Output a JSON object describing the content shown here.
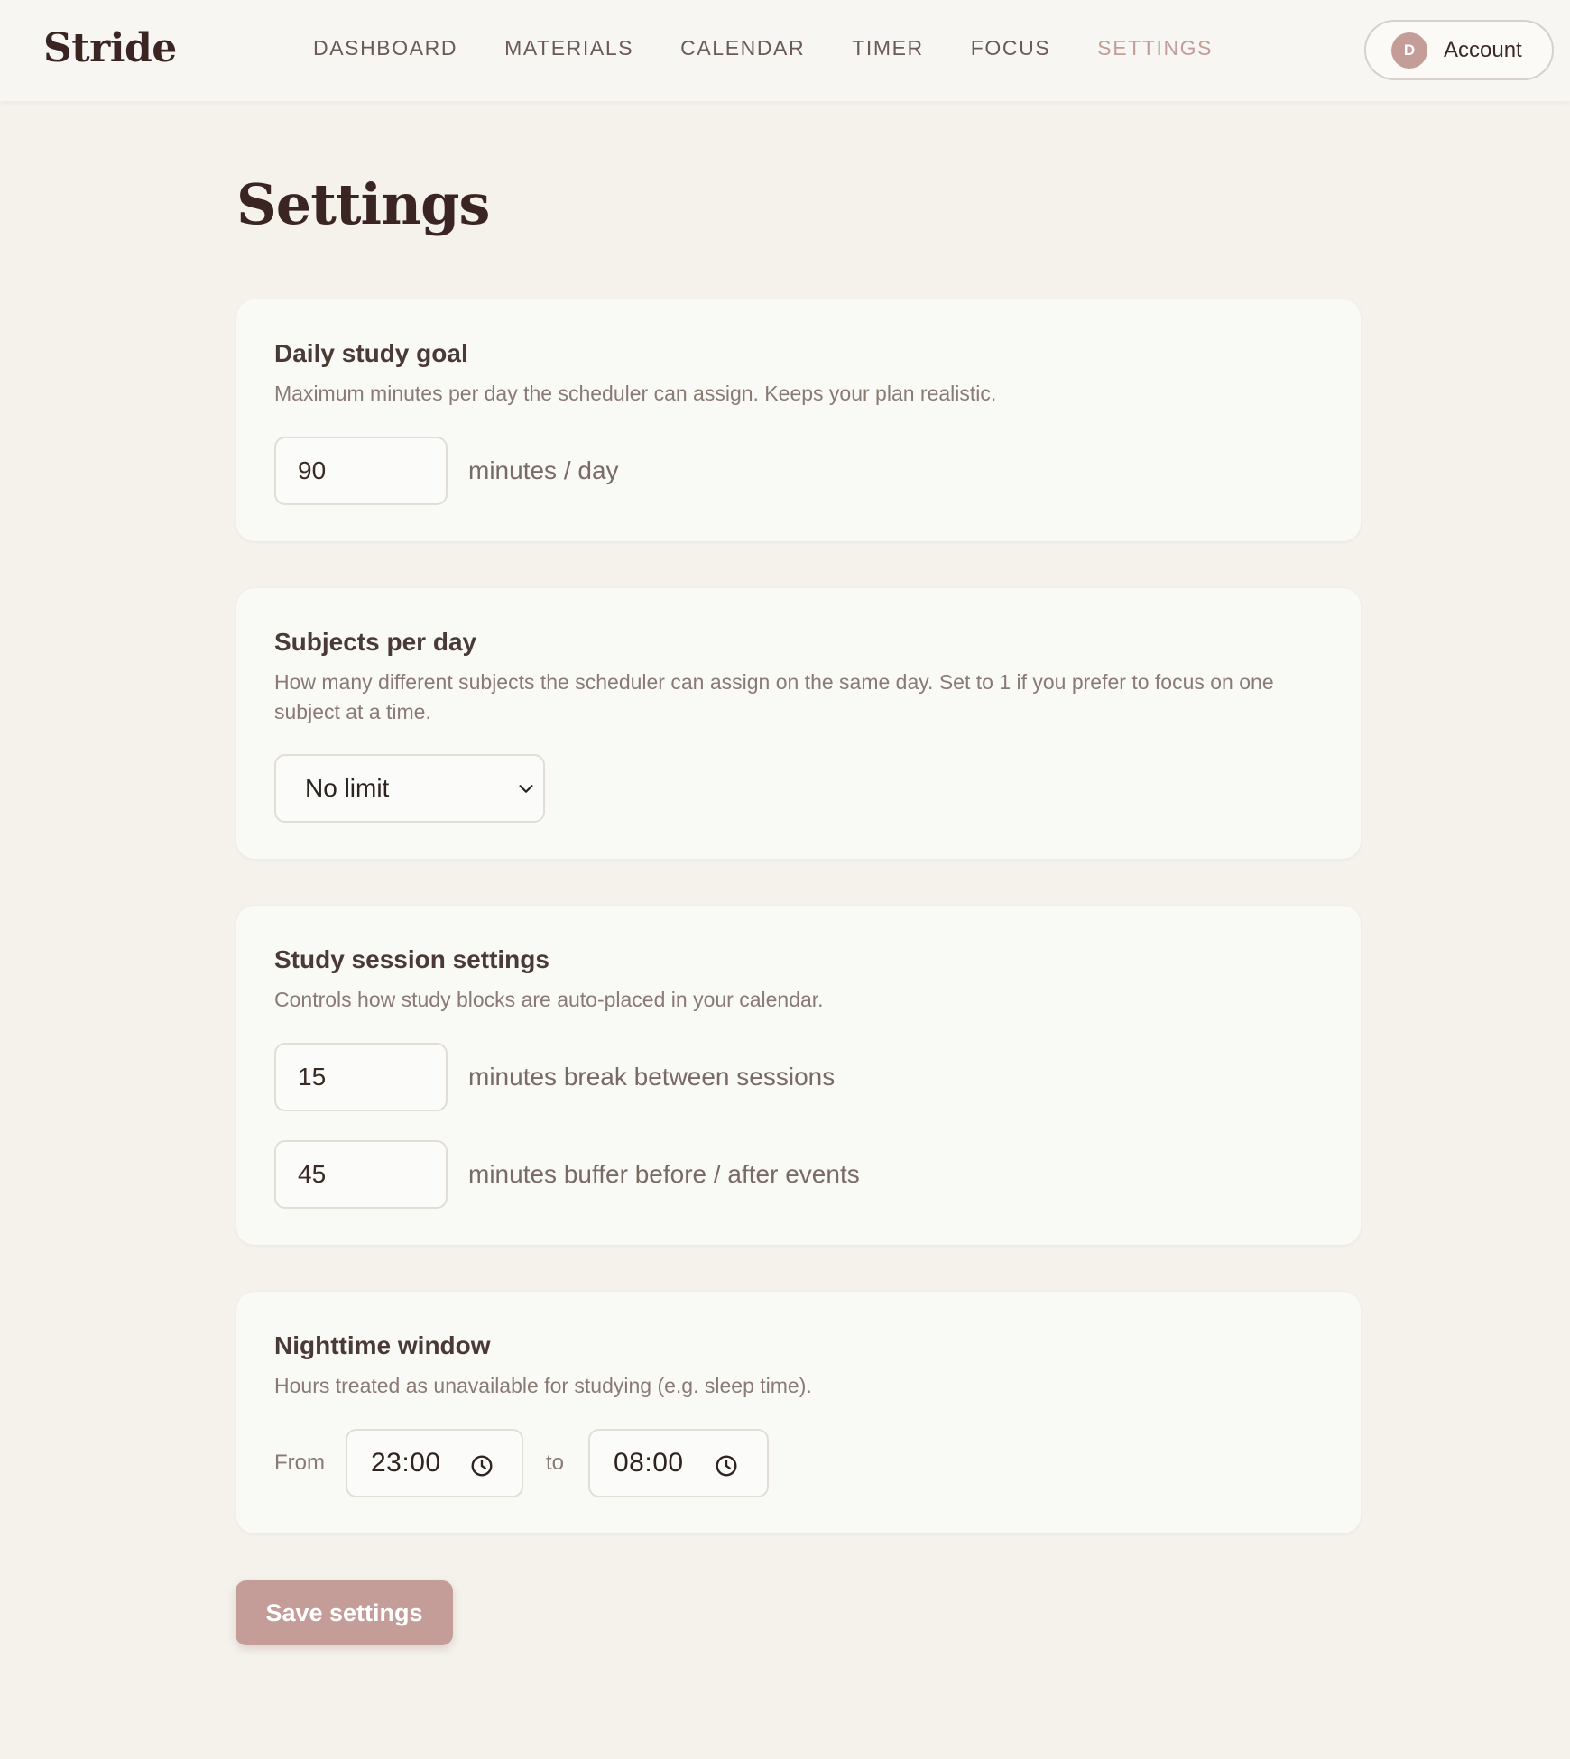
{
  "app": {
    "logo": "Stride",
    "nav": [
      "DASHBOARD",
      "MATERIALS",
      "CALENDAR",
      "TIMER",
      "FOCUS",
      "SETTINGS"
    ],
    "active_nav": "SETTINGS",
    "account": {
      "initial": "D",
      "label": "Account"
    }
  },
  "page": {
    "title": "Settings"
  },
  "daily_goal": {
    "title": "Daily study goal",
    "description": "Maximum minutes per day the scheduler can assign. Keeps your plan realistic.",
    "value": "90",
    "unit": "minutes / day"
  },
  "subjects": {
    "title": "Subjects per day",
    "description": "How many different subjects the scheduler can assign on the same day. Set to 1 if you prefer to focus on one subject at a time.",
    "selected": "No limit"
  },
  "session": {
    "title": "Study session settings",
    "description": "Controls how study blocks are auto-placed in your calendar.",
    "break_value": "15",
    "break_unit": "minutes break between sessions",
    "buffer_value": "45",
    "buffer_unit": "minutes buffer before / after events"
  },
  "night": {
    "title": "Nighttime window",
    "description": "Hours treated as unavailable for studying (e.g. sleep time).",
    "from_label": "From",
    "from_value": "23:00",
    "to_label": "to",
    "to_value": "08:00"
  },
  "actions": {
    "save_label": "Save settings"
  },
  "colors": {
    "accent": "#c49d98",
    "background": "#f5f2ec",
    "card": "#f9f9f6"
  }
}
